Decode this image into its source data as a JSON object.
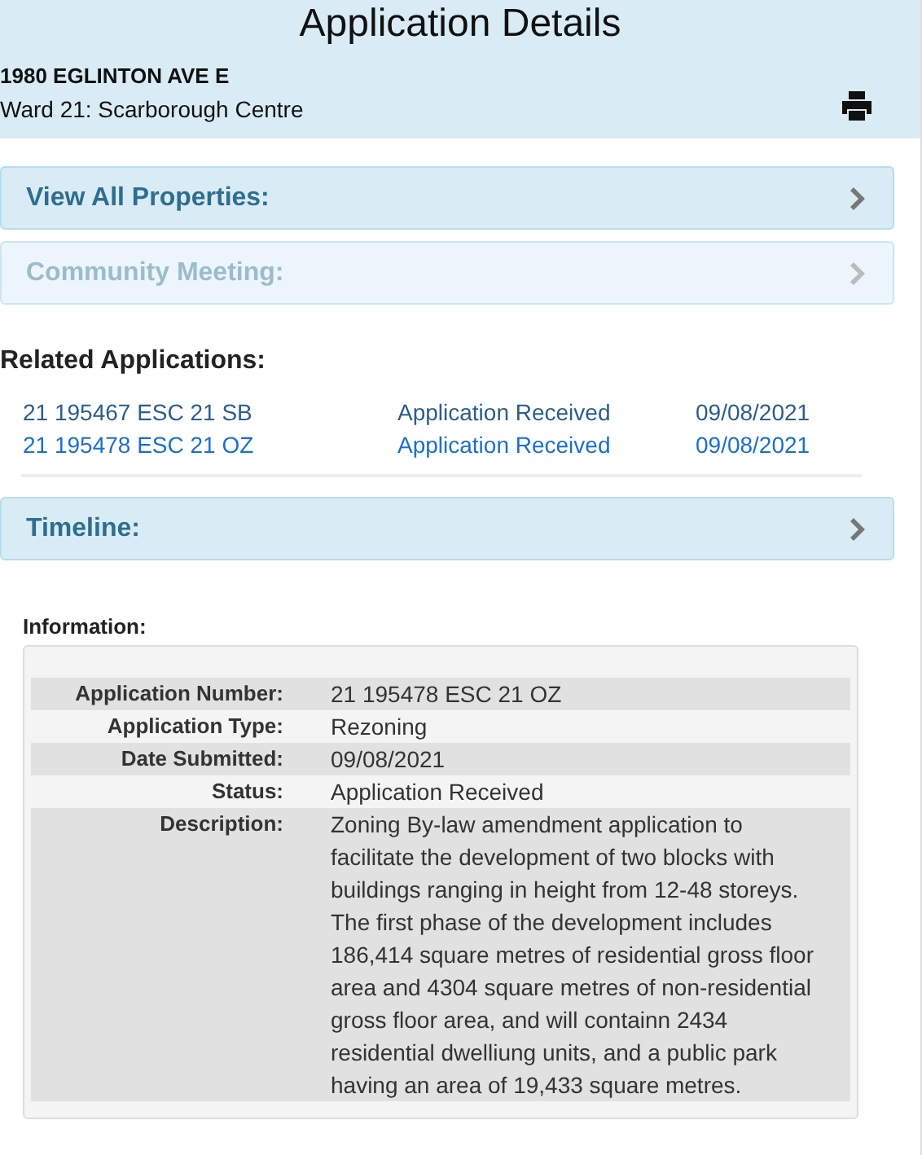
{
  "header": {
    "title": "Application Details",
    "address": "1980 EGLINTON AVE E",
    "ward": "Ward 21: Scarborough Centre"
  },
  "panels_top": [
    {
      "label": "View All Properties:",
      "disabled": false
    },
    {
      "label": "Community Meeting:",
      "disabled": true
    }
  ],
  "related": {
    "heading": "Related Applications:",
    "rows": [
      {
        "number": "21 195467 ESC 21 SB",
        "status": "Application Received",
        "date": "09/08/2021",
        "visited": true
      },
      {
        "number": "21 195478 ESC 21 OZ",
        "status": "Application Received",
        "date": "09/08/2021",
        "visited": false
      }
    ]
  },
  "panels_bottom": [
    {
      "label": "Timeline:",
      "disabled": false
    }
  ],
  "information": {
    "heading": "Information:",
    "rows": [
      {
        "label": "Application Number:",
        "value": "21 195478 ESC 21 OZ"
      },
      {
        "label": "Application Type:",
        "value": "Rezoning"
      },
      {
        "label": "Date Submitted:",
        "value": "09/08/2021"
      },
      {
        "label": "Status:",
        "value": "Application Received"
      },
      {
        "label": "Description:",
        "value": "Zoning By-law amendment application to facilitate the development of two blocks with buildings ranging in height from 12-48 storeys. The first phase of the development includes 186,414 square metres of residential gross floor area and 4304 square metres of non-residential gross floor area, and will containn 2434 residential dwelliung units, and a public park having an area of 19,433 square metres."
      }
    ]
  }
}
